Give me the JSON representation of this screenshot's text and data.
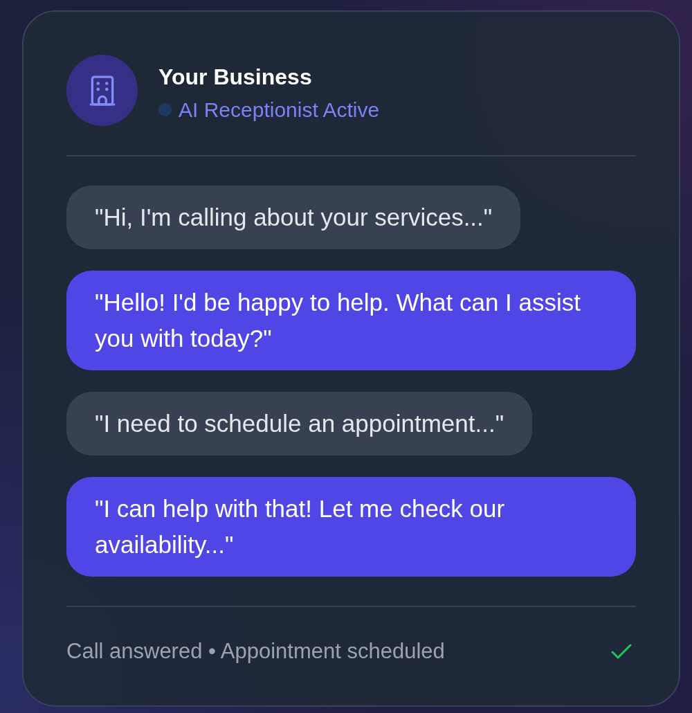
{
  "header": {
    "title": "Your Business",
    "status": {
      "text": "AI Receptionist Active",
      "color": "#1e3a5f"
    }
  },
  "messages": [
    {
      "kind": "caller",
      "text": "\"Hi, I'm calling about your services...\""
    },
    {
      "kind": "ai",
      "text": "\"Hello! I'd be happy to help. What can I assist you with today?\""
    },
    {
      "kind": "caller",
      "text": "\"I need to schedule an appointment...\""
    },
    {
      "kind": "ai",
      "text": "\"I can help with that! Let me check our availability...\""
    }
  ],
  "footer": {
    "text": "Call answered • Appointment scheduled",
    "checked": true
  }
}
